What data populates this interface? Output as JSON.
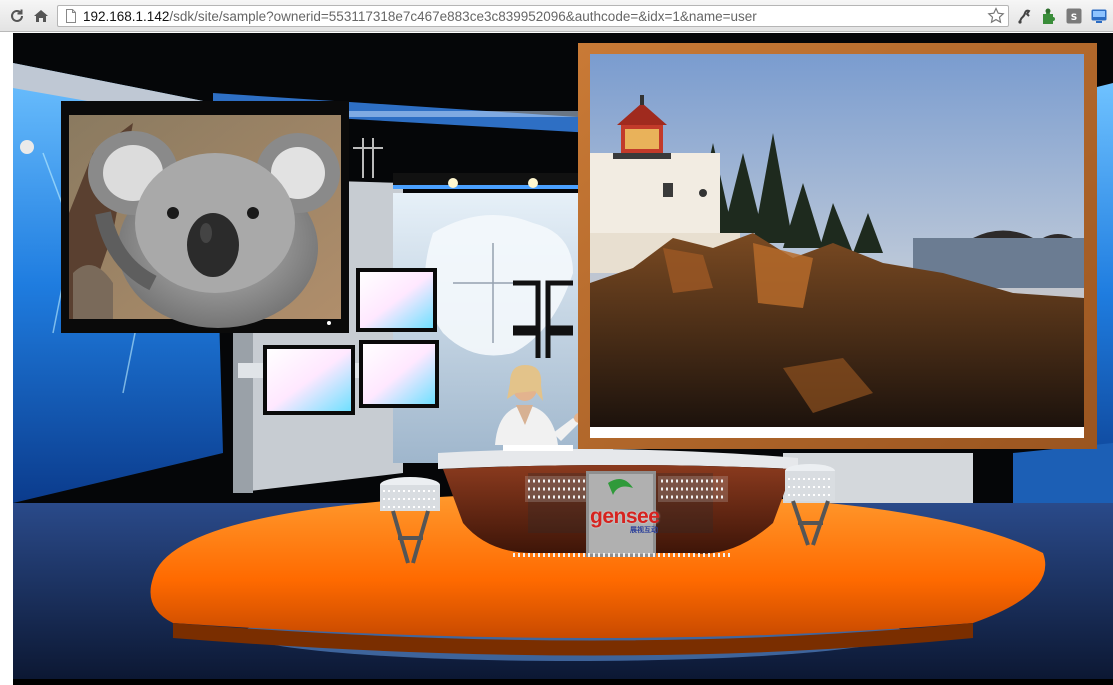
{
  "browser": {
    "url_host": "192.168.1.142",
    "url_path": "/sdk/site/sample?ownerid=553117318e7c467e883ce3c839952096&authcode=&idx=1&name=user",
    "icons": [
      "reload-icon",
      "home-icon",
      "page-icon",
      "bookmark-star-icon",
      "extension-icon",
      "puzzle-icon",
      "sogou-icon",
      "menu-icon"
    ]
  },
  "stage": {
    "logo": "gensee",
    "logo_sub": "展视互动"
  },
  "colors": {
    "desk_orange": "#ff7a10",
    "studio_blue": "#2f8fe0",
    "frame_wood": "#b86b2a",
    "logo_red": "#d6231f"
  }
}
